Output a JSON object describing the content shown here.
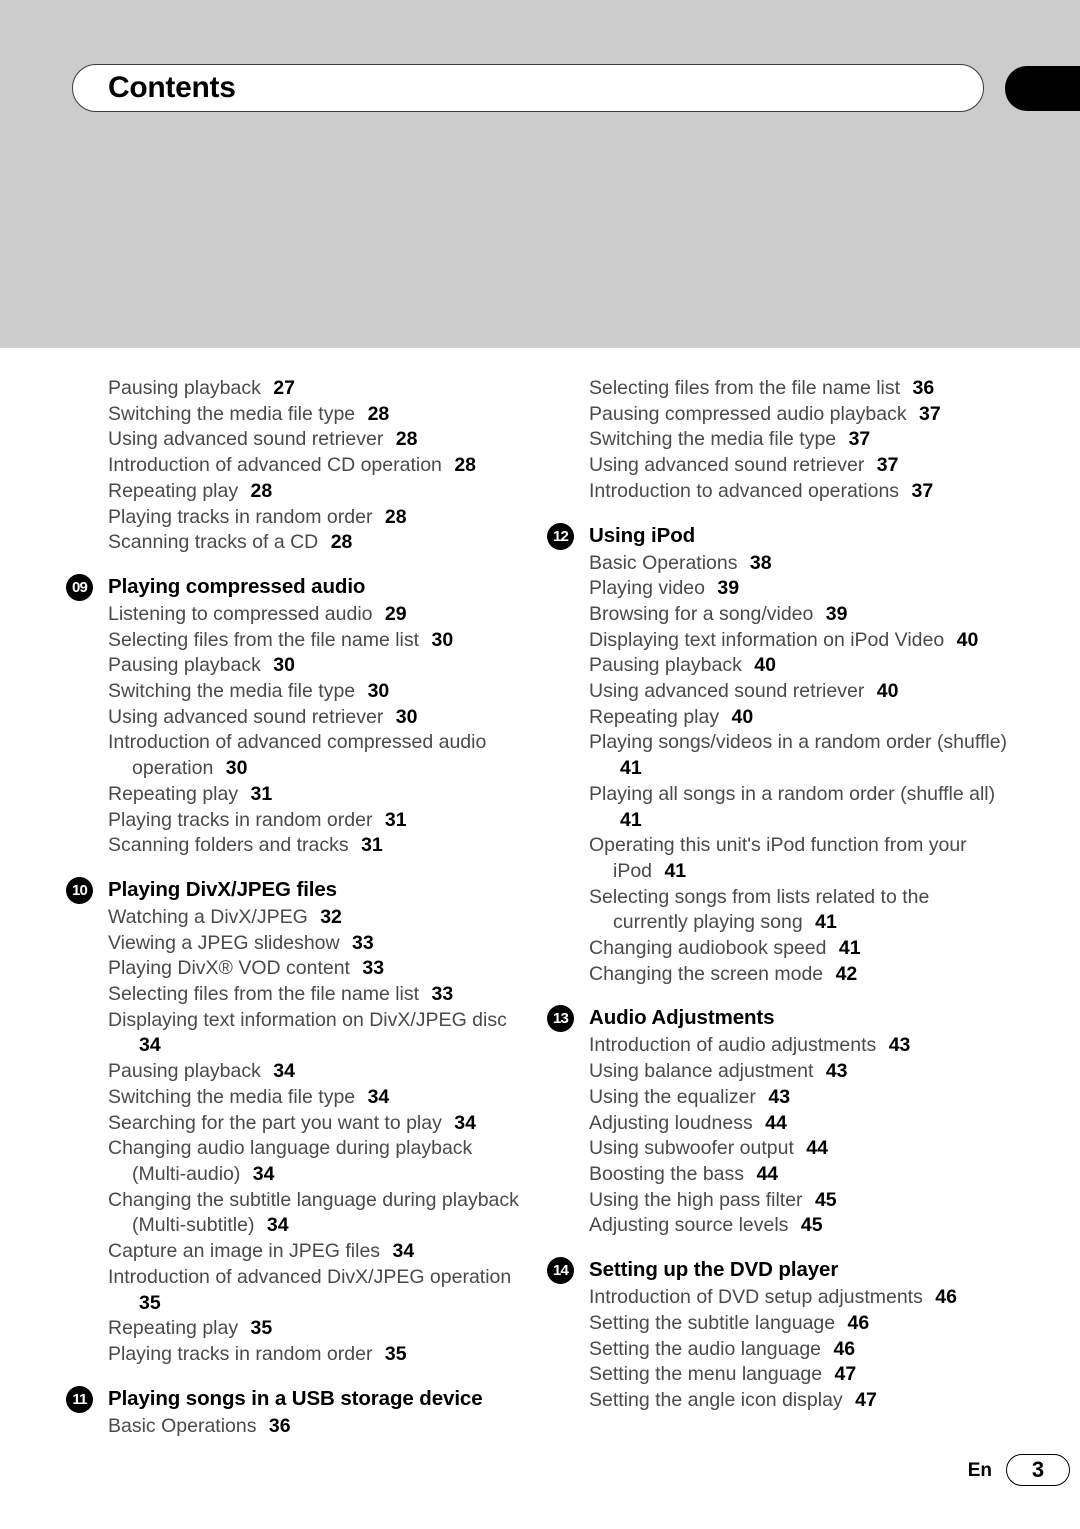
{
  "page": {
    "title": "Contents",
    "footer_language": "En",
    "footer_page_number": "3",
    "accent_black": "#000000",
    "header_band_gray": "#cccccc",
    "entry_text_gray": "#4a4a4a"
  },
  "columns": {
    "left": [
      {
        "kind": "entry",
        "text": "Pausing playback",
        "page": "27"
      },
      {
        "kind": "entry",
        "text": "Switching the media file type",
        "page": "28"
      },
      {
        "kind": "entry",
        "text": "Using advanced sound retriever",
        "page": "28"
      },
      {
        "kind": "entry",
        "text": "Introduction of advanced CD operation",
        "page": "28"
      },
      {
        "kind": "entry",
        "text": "Repeating play",
        "page": "28"
      },
      {
        "kind": "entry",
        "text": "Playing tracks in random order",
        "page": "28"
      },
      {
        "kind": "entry",
        "text": "Scanning tracks of a CD",
        "page": "28"
      },
      {
        "kind": "section",
        "number": "09",
        "title": "Playing compressed audio"
      },
      {
        "kind": "entry",
        "text": "Listening to compressed audio",
        "page": "29"
      },
      {
        "kind": "entry",
        "text": "Selecting files from the file name list",
        "page": "30"
      },
      {
        "kind": "entry",
        "text": "Pausing playback",
        "page": "30"
      },
      {
        "kind": "entry",
        "text": "Switching the media file type",
        "page": "30"
      },
      {
        "kind": "entry",
        "text": "Using advanced sound retriever",
        "page": "30"
      },
      {
        "kind": "entry",
        "text": "Introduction of advanced compressed audio operation",
        "page": "30"
      },
      {
        "kind": "entry",
        "text": "Repeating play",
        "page": "31"
      },
      {
        "kind": "entry",
        "text": "Playing tracks in random order",
        "page": "31"
      },
      {
        "kind": "entry",
        "text": "Scanning folders and tracks",
        "page": "31"
      },
      {
        "kind": "section",
        "number": "10",
        "title": "Playing DivX/JPEG files"
      },
      {
        "kind": "entry",
        "text": "Watching a DivX/JPEG",
        "page": "32"
      },
      {
        "kind": "entry",
        "text": "Viewing a JPEG slideshow",
        "page": "33"
      },
      {
        "kind": "entry",
        "text": "Playing DivX® VOD content",
        "page": "33"
      },
      {
        "kind": "entry",
        "text": "Selecting files from the file name list",
        "page": "33"
      },
      {
        "kind": "entry",
        "text": "Displaying text information on DivX/JPEG disc",
        "page": "34"
      },
      {
        "kind": "entry",
        "text": "Pausing playback",
        "page": "34"
      },
      {
        "kind": "entry",
        "text": "Switching the media file type",
        "page": "34"
      },
      {
        "kind": "entry",
        "text": "Searching for the part you want to play",
        "page": "34"
      },
      {
        "kind": "entry",
        "text": "Changing audio language during playback (Multi-audio)",
        "page": "34"
      },
      {
        "kind": "entry",
        "text": "Changing the subtitle language during playback (Multi-subtitle)",
        "page": "34"
      },
      {
        "kind": "entry",
        "text": "Capture an image in JPEG files",
        "page": "34"
      },
      {
        "kind": "entry",
        "text": "Introduction of advanced DivX/JPEG operation",
        "page": "35"
      },
      {
        "kind": "entry",
        "text": "Repeating play",
        "page": "35"
      },
      {
        "kind": "entry",
        "text": "Playing tracks in random order",
        "page": "35"
      },
      {
        "kind": "section",
        "number": "11",
        "title": "Playing songs in a USB storage device"
      },
      {
        "kind": "entry",
        "text": "Basic Operations",
        "page": "36"
      }
    ],
    "right": [
      {
        "kind": "entry",
        "text": "Selecting files from the file name list",
        "page": "36"
      },
      {
        "kind": "entry",
        "text": "Pausing compressed audio playback",
        "page": "37"
      },
      {
        "kind": "entry",
        "text": "Switching the media file type",
        "page": "37"
      },
      {
        "kind": "entry",
        "text": "Using advanced sound retriever",
        "page": "37"
      },
      {
        "kind": "entry",
        "text": "Introduction to advanced operations",
        "page": "37"
      },
      {
        "kind": "section",
        "number": "12",
        "title": "Using iPod"
      },
      {
        "kind": "entry",
        "text": "Basic Operations",
        "page": "38"
      },
      {
        "kind": "entry",
        "text": "Playing video",
        "page": "39"
      },
      {
        "kind": "entry",
        "text": "Browsing for a song/video",
        "page": "39"
      },
      {
        "kind": "entry",
        "text": "Displaying text information on iPod Video",
        "page": "40"
      },
      {
        "kind": "entry",
        "text": "Pausing playback",
        "page": "40"
      },
      {
        "kind": "entry",
        "text": "Using advanced sound retriever",
        "page": "40"
      },
      {
        "kind": "entry",
        "text": "Repeating play",
        "page": "40"
      },
      {
        "kind": "entry",
        "text": "Playing songs/videos in a random order (shuffle)",
        "page": "41"
      },
      {
        "kind": "entry",
        "text": "Playing all songs in a random order (shuffle all)",
        "page": "41"
      },
      {
        "kind": "entry",
        "text": "Operating this unit's iPod function from your iPod",
        "page": "41"
      },
      {
        "kind": "entry",
        "text": "Selecting songs from lists related to the currently playing song",
        "page": "41"
      },
      {
        "kind": "entry",
        "text": "Changing audiobook speed",
        "page": "41"
      },
      {
        "kind": "entry",
        "text": "Changing the screen mode",
        "page": "42"
      },
      {
        "kind": "section",
        "number": "13",
        "title": "Audio Adjustments"
      },
      {
        "kind": "entry",
        "text": "Introduction of audio adjustments",
        "page": "43"
      },
      {
        "kind": "entry",
        "text": "Using balance adjustment",
        "page": "43"
      },
      {
        "kind": "entry",
        "text": "Using the equalizer",
        "page": "43"
      },
      {
        "kind": "entry",
        "text": "Adjusting loudness",
        "page": "44"
      },
      {
        "kind": "entry",
        "text": "Using subwoofer output",
        "page": "44"
      },
      {
        "kind": "entry",
        "text": "Boosting the bass",
        "page": "44"
      },
      {
        "kind": "entry",
        "text": "Using the high pass filter",
        "page": "45"
      },
      {
        "kind": "entry",
        "text": "Adjusting source levels",
        "page": "45"
      },
      {
        "kind": "section",
        "number": "14",
        "title": "Setting up the DVD player"
      },
      {
        "kind": "entry",
        "text": "Introduction of DVD setup adjustments",
        "page": "46"
      },
      {
        "kind": "entry",
        "text": "Setting the subtitle language",
        "page": "46"
      },
      {
        "kind": "entry",
        "text": "Setting the audio language",
        "page": "46"
      },
      {
        "kind": "entry",
        "text": "Setting the menu language",
        "page": "47"
      },
      {
        "kind": "entry",
        "text": "Setting the angle icon display",
        "page": "47"
      }
    ]
  }
}
